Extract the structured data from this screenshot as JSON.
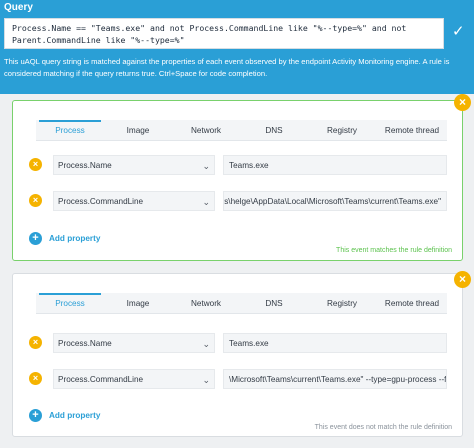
{
  "query": {
    "title": "Query",
    "text": "Process.Name == \"Teams.exe\" and not Process.CommandLine like \"%--type=%\" and not Parent.CommandLine like \"%--type=%\"",
    "help": "This uAQL query string is matched against the properties of each event observed by the endpoint Activity Monitoring engine. A rule is considered matching if the query returns true. Ctrl+Space for code completion.",
    "check_icon": "check-icon",
    "accent": "#2a9fd6"
  },
  "tabs": [
    "Process",
    "Image",
    "Network",
    "DNS",
    "Registry",
    "Remote thread"
  ],
  "events": [
    {
      "active_tab": "Process",
      "properties": [
        {
          "name": "Process.Name",
          "value": "Teams.exe"
        },
        {
          "name": "Process.CommandLine",
          "value": "ers\\helge\\AppData\\Local\\Microsoft\\Teams\\current\\Teams.exe\""
        }
      ],
      "add_label": "Add property",
      "status": "This event matches the rule definition",
      "status_color": "#5cc24e"
    },
    {
      "active_tab": "Process",
      "properties": [
        {
          "name": "Process.Name",
          "value": "Teams.exe"
        },
        {
          "name": "Process.CommandLine",
          "value": "\\Microsoft\\Teams\\current\\Teams.exe\" --type=gpu-process --fiel"
        }
      ],
      "add_label": "Add property",
      "status": "This event does not match the rule definition",
      "status_color": "#8a929b"
    }
  ]
}
